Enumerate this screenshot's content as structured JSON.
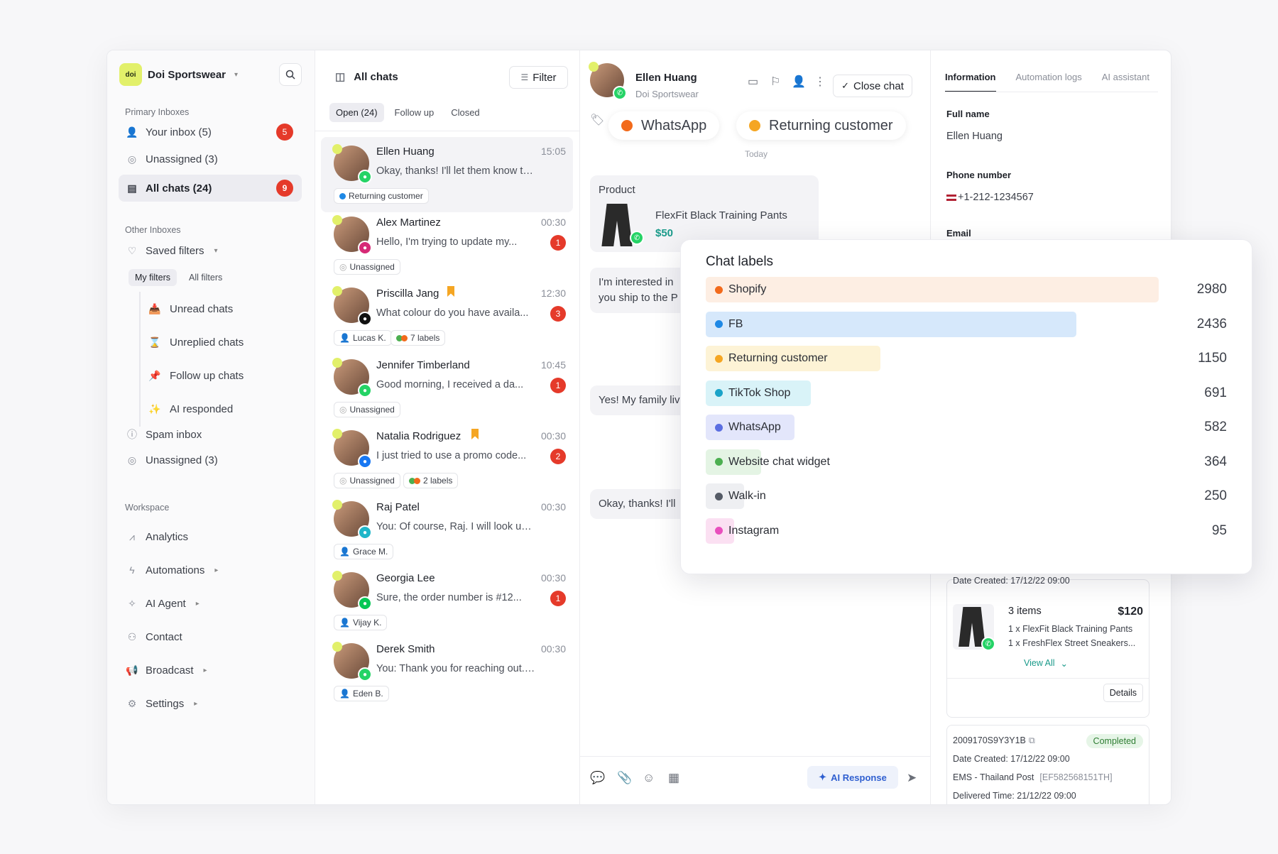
{
  "sidebar": {
    "brand": "Doi Sportswear",
    "logo_text": "doi",
    "primary_label": "Primary Inboxes",
    "primary": [
      {
        "label": "Your inbox (5)",
        "badge": "5"
      },
      {
        "label": "Unassigned (3)",
        "badge": ""
      },
      {
        "label": "All chats (24)",
        "badge": "9"
      }
    ],
    "other_label": "Other Inboxes",
    "saved_filters": "Saved filters",
    "filter_tabs": [
      "My filters",
      "All filters"
    ],
    "filters": [
      "Unread chats",
      "Unreplied chats",
      "Follow up chats",
      "AI responded"
    ],
    "other": [
      "Spam inbox",
      "Unassigned (3)"
    ],
    "workspace_label": "Workspace",
    "workspace": [
      "Analytics",
      "Automations",
      "AI Agent",
      "Contact",
      "Broadcast",
      "Settings"
    ]
  },
  "chatlist": {
    "title": "All chats",
    "filter": "Filter",
    "tabs": [
      "Open (24)",
      "Follow up",
      "Closed"
    ],
    "chats": [
      {
        "name": "Ellen Huang",
        "time": "15:05",
        "msg": "Okay, thanks! I'll let them know to c...",
        "badge": "",
        "tag1": "Returning customer",
        "tag2": "",
        "channel_color": "#25d366"
      },
      {
        "name": "Alex Martinez",
        "time": "00:30",
        "msg": "Hello, I'm trying to update my...",
        "badge": "1",
        "tag1": "Unassigned",
        "tag2": "",
        "channel_color": "#d62976"
      },
      {
        "name": "Priscilla Jang",
        "time": "12:30",
        "msg": "What colour do you have availa...",
        "badge": "3",
        "tag1": "Lucas K.",
        "tag2": "7 labels",
        "channel_color": "#111111"
      },
      {
        "name": "Jennifer Timberland",
        "time": "10:45",
        "msg": "Good morning, I received a da...",
        "badge": "1",
        "tag1": "Unassigned",
        "tag2": "",
        "channel_color": "#25d366"
      },
      {
        "name": "Natalia Rodriguez",
        "time": "00:30",
        "msg": "I just tried to use a promo code...",
        "badge": "2",
        "tag1": "Unassigned",
        "tag2": "2 labels",
        "channel_color": "#1877f2"
      },
      {
        "name": "Raj Patel",
        "time": "00:30",
        "msg": "You: Of course, Raj. I will look up yo...",
        "badge": "",
        "tag1": "Grace M.",
        "tag2": "",
        "channel_color": "#1fb6c9"
      },
      {
        "name": "Georgia Lee",
        "time": "00:30",
        "msg": "Sure, the order number is #12...",
        "badge": "1",
        "tag1": "Vijay K.",
        "tag2": "",
        "channel_color": "#06c755"
      },
      {
        "name": "Derek Smith",
        "time": "00:30",
        "msg": "You: Thank you for reaching out. Ca...",
        "badge": "",
        "tag1": "Eden B.",
        "tag2": "",
        "channel_color": "#25d366"
      }
    ]
  },
  "conversation": {
    "name": "Ellen Huang",
    "company": "Doi Sportswear",
    "close": "Close chat",
    "labels": [
      "WhatsApp",
      "Returning customer"
    ],
    "today": "Today",
    "product_label": "Product",
    "product_name": "FlexFit Black Training Pants",
    "product_price": "$50",
    "msg1a": "I'm interested in",
    "msg1b": "you ship to the P",
    "msg2": "Yes! My family liv",
    "msg3": "Okay, thanks! I'll",
    "ai_button": "AI Response"
  },
  "info": {
    "tabs": [
      "Information",
      "Automation logs",
      "AI assistant"
    ],
    "full_name_label": "Full name",
    "full_name": "Ellen Huang",
    "phone_label": "Phone number",
    "phone": "+1-212-1234567",
    "email_label": "Email",
    "order1_date": "Date Created: 17/12/22 09:00",
    "order1_items": "3 items",
    "order1_total": "$120",
    "order1_line1": "1 x FlexFit Black Training Pants",
    "order1_line2": "1 x FreshFlex Street Sneakers...",
    "view_all": "View All",
    "details": "Details",
    "order2_id": "2009170S9Y3Y1B",
    "order2_status": "Completed",
    "order2_date": "Date Created: 17/12/22 09:00",
    "order2_ship": "EMS - Thailand Post",
    "order2_track": "[EF582568151TH]",
    "order2_delivered": "Delivered Time: 21/12/22 09:00"
  },
  "chat_data": {
    "type": "bar",
    "title": "Chat labels",
    "categories": [
      "Shopify",
      "FB",
      "Returning customer",
      "TikTok Shop",
      "WhatsApp",
      "Website chat widget",
      "Walk-in",
      "Instagram"
    ],
    "values": [
      2980,
      2436,
      1150,
      691,
      582,
      364,
      250,
      95
    ],
    "dot_colors": [
      "#f26a1b",
      "#1e88e5",
      "#f5a623",
      "#1aa3c8",
      "#5b6ee1",
      "#4caf50",
      "#555b66",
      "#e94fbd"
    ],
    "bar_colors": [
      "#fdeee3",
      "#d6e8fb",
      "#fdf3d6",
      "#d9f3f8",
      "#e3e6fb",
      "#e4f4e4",
      "#eeeff2",
      "#fbe0f2"
    ]
  }
}
